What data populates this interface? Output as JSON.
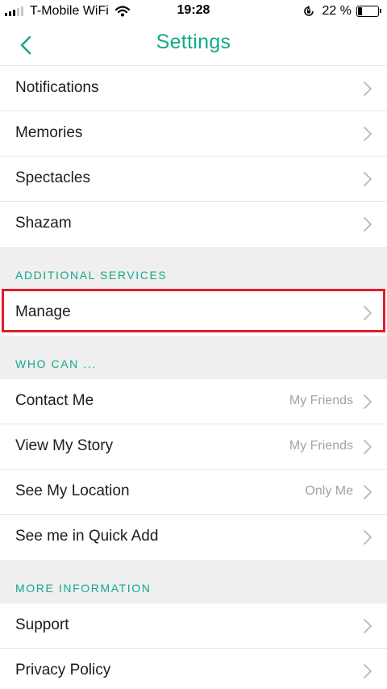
{
  "status_bar": {
    "carrier": "T-Mobile WiFi",
    "time": "19:28",
    "battery_percent": "22 %",
    "battery_level": 0.22
  },
  "nav": {
    "title": "Settings",
    "back_icon": "chevron-left-icon"
  },
  "rows_top": [
    {
      "label": "Notifications",
      "value": ""
    },
    {
      "label": "Memories",
      "value": ""
    },
    {
      "label": "Spectacles",
      "value": ""
    },
    {
      "label": "Shazam",
      "value": ""
    }
  ],
  "sections": {
    "additional_services": {
      "title": "ADDITIONAL SERVICES",
      "items": [
        {
          "label": "Manage",
          "value": ""
        }
      ]
    },
    "who_can": {
      "title": "WHO CAN ...",
      "items": [
        {
          "label": "Contact Me",
          "value": "My Friends"
        },
        {
          "label": "View My Story",
          "value": "My Friends"
        },
        {
          "label": "See My Location",
          "value": "Only Me"
        },
        {
          "label": "See me in Quick Add",
          "value": ""
        }
      ]
    },
    "more_information": {
      "title": "MORE INFORMATION",
      "items": [
        {
          "label": "Support",
          "value": ""
        },
        {
          "label": "Privacy Policy",
          "value": ""
        }
      ]
    }
  },
  "colors": {
    "accent": "#12a98a",
    "highlight": "#e01d2c",
    "section_bg": "#efefef",
    "secondary_text": "#a3a3a3"
  }
}
